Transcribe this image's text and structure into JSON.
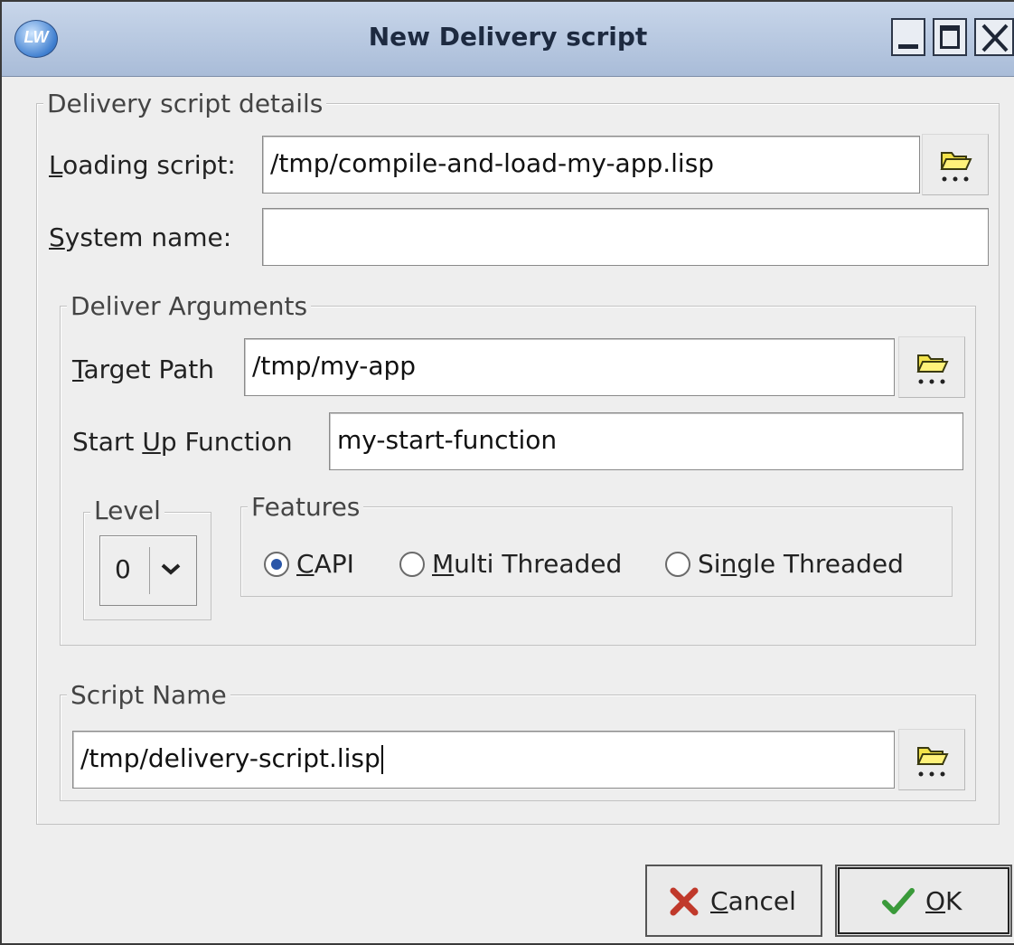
{
  "window": {
    "title": "New Delivery script",
    "app_icon_text": "LW"
  },
  "details": {
    "legend": "Delivery script details",
    "loading_label_key": "L",
    "loading_label_rest": "oading script:",
    "loading_value": "/tmp/compile-and-load-my-app.lisp",
    "system_label_key": "S",
    "system_label_rest": "ystem name:",
    "system_value": ""
  },
  "deliver": {
    "legend": "Deliver Arguments",
    "target_label_key": "T",
    "target_label_rest": "arget Path",
    "target_value": "/tmp/my-app",
    "startup_label_pre": "Start ",
    "startup_label_key": "U",
    "startup_label_rest": "p Function",
    "startup_value": "my-start-function",
    "level_legend": "Level",
    "level_value": "0",
    "features_legend": "Features",
    "features": [
      {
        "key": "C",
        "rest": "API",
        "selected": true
      },
      {
        "key": "M",
        "rest": "ulti Threaded",
        "selected": false
      },
      {
        "pre": "Si",
        "key": "n",
        "rest": "gle Threaded",
        "selected": false
      }
    ]
  },
  "script": {
    "legend": "Script Name",
    "value": "/tmp/delivery-script.lisp"
  },
  "buttons": {
    "cancel_key": "C",
    "cancel_rest": "ancel",
    "ok_key": "O",
    "ok_rest": "K"
  },
  "icons": {
    "browse": "folder-browse-icon",
    "cancel": "red-x-icon",
    "ok": "green-check-icon",
    "dropdown": "chevron-down-icon"
  },
  "colors": {
    "titlebar": "#b8c8e0",
    "radio_selected": "#2a56a8",
    "cancel_icon": "#c0392b",
    "ok_icon": "#3a9a3a"
  }
}
